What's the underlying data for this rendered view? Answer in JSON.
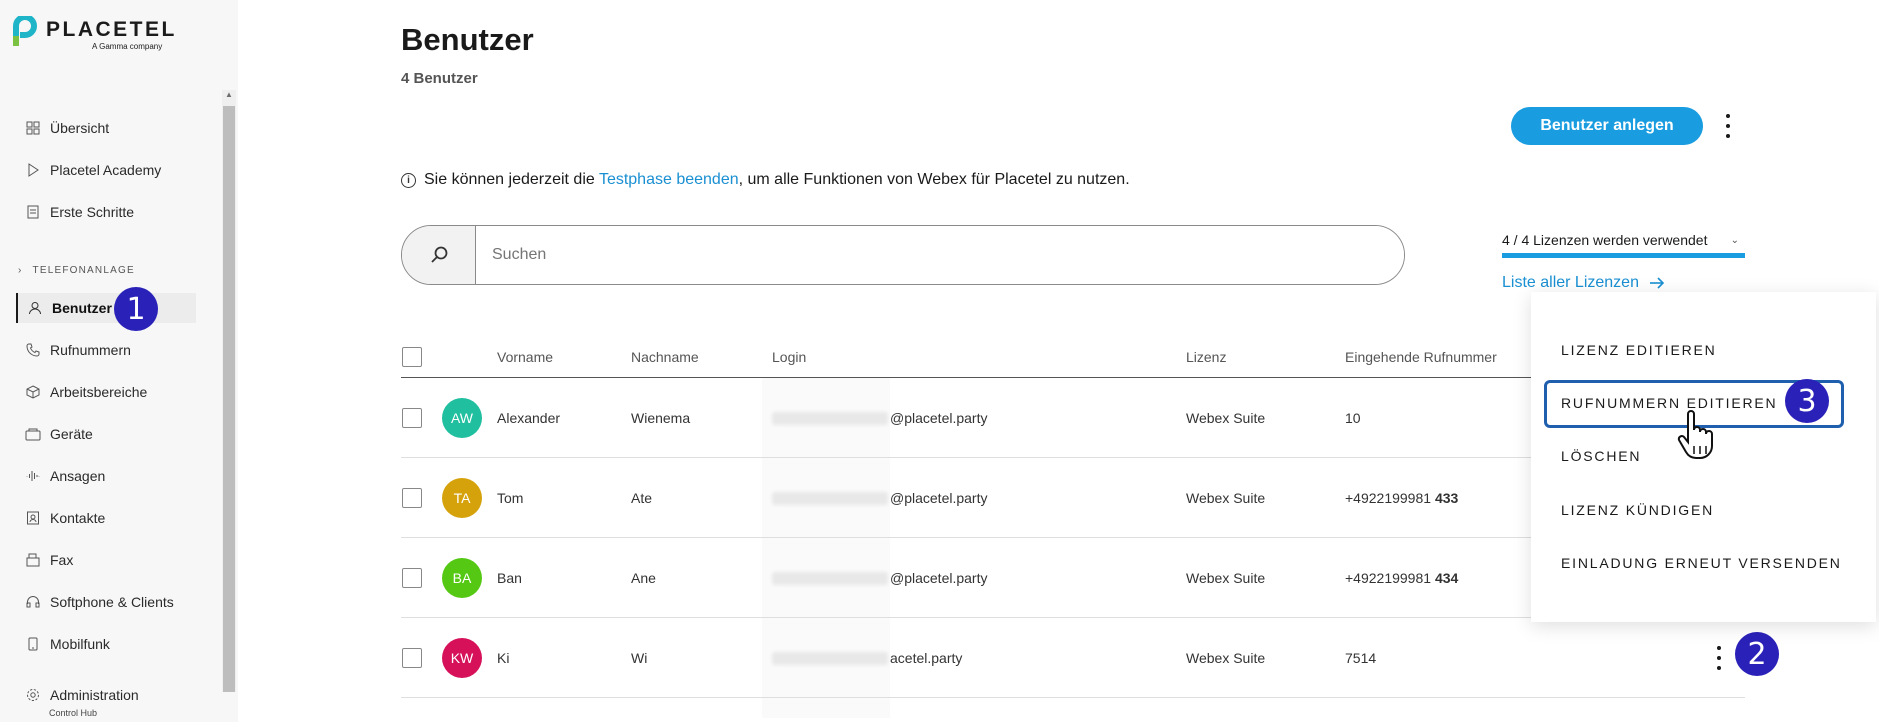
{
  "brand": {
    "name": "PLACETEL",
    "tagline": "A Gamma company"
  },
  "sidebar": {
    "items_top": [
      {
        "label": "Übersicht",
        "icon": "grid-icon"
      },
      {
        "label": "Placetel Academy",
        "icon": "play-icon"
      },
      {
        "label": "Erste Schritte",
        "icon": "document-icon"
      }
    ],
    "section_label": "TELEFONANLAGE",
    "items": [
      {
        "label": "Benutzer",
        "icon": "user-icon",
        "active": true
      },
      {
        "label": "Rufnummern",
        "icon": "phone-icon"
      },
      {
        "label": "Arbeitsbereiche",
        "icon": "cube-icon"
      },
      {
        "label": "Geräte",
        "icon": "device-icon"
      },
      {
        "label": "Ansagen",
        "icon": "audio-wave-icon"
      },
      {
        "label": "Kontakte",
        "icon": "contacts-icon"
      },
      {
        "label": "Fax",
        "icon": "fax-icon"
      },
      {
        "label": "Softphone & Clients",
        "icon": "headset-icon"
      },
      {
        "label": "Mobilfunk",
        "icon": "mobile-icon"
      }
    ],
    "admin": {
      "label": "Administration",
      "sublabel": "Control Hub",
      "icon": "gear-icon"
    }
  },
  "annotations": {
    "step1": "1",
    "step2": "2",
    "step3": "3"
  },
  "page": {
    "title": "Benutzer",
    "subtitle": "4 Benutzer",
    "primary_button": "Benutzer anlegen",
    "info": {
      "before": "Sie können jederzeit die ",
      "link": "Testphase beenden",
      "after": ", um alle Funktionen von Webex für Placetel zu nutzen."
    },
    "search_placeholder": "Suchen",
    "license_select": "4 / 4 Lizenzen werden verwendet",
    "license_link": "Liste aller Lizenzen"
  },
  "table": {
    "columns": [
      "Vorname",
      "Nachname",
      "Login",
      "Lizenz",
      "Eingehende Rufnummer"
    ],
    "rows": [
      {
        "initials": "AW",
        "avatar_color": "#1fbf9f",
        "first": "Alexander",
        "last": "Wienema",
        "login_suffix": "@placetel.party",
        "license": "Webex Suite",
        "number_prefix": "10",
        "number_bold": ""
      },
      {
        "initials": "TA",
        "avatar_color": "#d6a20c",
        "first": "Tom",
        "last": "Ate",
        "login_suffix": "@placetel.party",
        "license": "Webex Suite",
        "number_prefix": "+4922199981 ",
        "number_bold": "433"
      },
      {
        "initials": "BA",
        "avatar_color": "#55c814",
        "first": "Ban",
        "last": "Ane",
        "login_suffix": "@placetel.party",
        "license": "Webex Suite",
        "number_prefix": "+4922199981 ",
        "number_bold": "434"
      },
      {
        "initials": "KW",
        "avatar_color": "#d6115a",
        "first": "Ki",
        "last": "Wi",
        "login_suffix": "acetel.party",
        "license": "Webex Suite",
        "number_prefix": "7514",
        "number_bold": ""
      }
    ]
  },
  "context_menu": {
    "items": [
      "LIZENZ EDITIEREN",
      "RUFNUMMERN EDITIEREN",
      "LÖSCHEN",
      "LIZENZ KÜNDIGEN",
      "EINLADUNG ERNEUT VERSENDEN"
    ],
    "highlighted_index": 1
  }
}
